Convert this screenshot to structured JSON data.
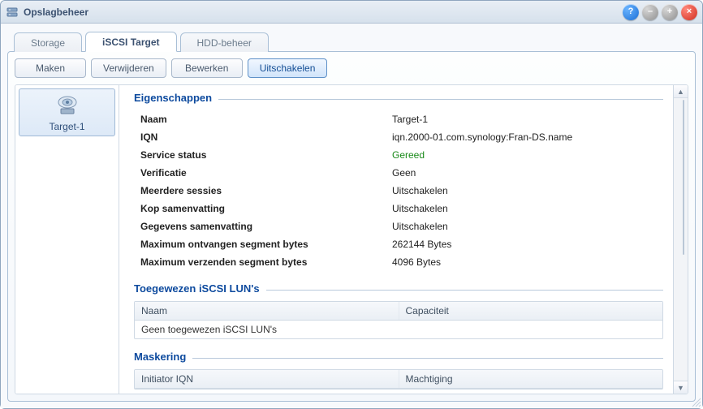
{
  "window": {
    "title": "Opslagbeheer"
  },
  "tabs": [
    {
      "label": "Storage"
    },
    {
      "label": "iSCSI Target"
    },
    {
      "label": "HDD-beheer"
    }
  ],
  "toolbar": {
    "create": "Maken",
    "delete": "Verwijderen",
    "edit": "Bewerken",
    "disable": "Uitschakelen"
  },
  "sidebar": {
    "targets": [
      {
        "label": "Target-1"
      }
    ]
  },
  "sections": {
    "properties": {
      "title": "Eigenschappen",
      "rows": {
        "name": {
          "label": "Naam",
          "value": "Target-1"
        },
        "iqn": {
          "label": "IQN",
          "value": "iqn.2000-01.com.synology:Fran-DS.name"
        },
        "service_status": {
          "label": "Service status",
          "value": "Gereed"
        },
        "verification": {
          "label": "Verificatie",
          "value": "Geen"
        },
        "sessions": {
          "label": "Meerdere sessies",
          "value": "Uitschakelen"
        },
        "header_digest": {
          "label": "Kop samenvatting",
          "value": "Uitschakelen"
        },
        "data_digest": {
          "label": "Gegevens samenvatting",
          "value": "Uitschakelen"
        },
        "max_recv": {
          "label": "Maximum ontvangen segment bytes",
          "value": "262144 Bytes"
        },
        "max_send": {
          "label": "Maximum verzenden segment bytes",
          "value": "4096 Bytes"
        }
      }
    },
    "luns": {
      "title": "Toegewezen iSCSI LUN's",
      "columns": {
        "name": "Naam",
        "capacity": "Capaciteit"
      },
      "empty": "Geen toegewezen iSCSI LUN's"
    },
    "masking": {
      "title": "Maskering",
      "columns": {
        "initiator": "Initiator IQN",
        "permission": "Machtiging"
      }
    }
  }
}
